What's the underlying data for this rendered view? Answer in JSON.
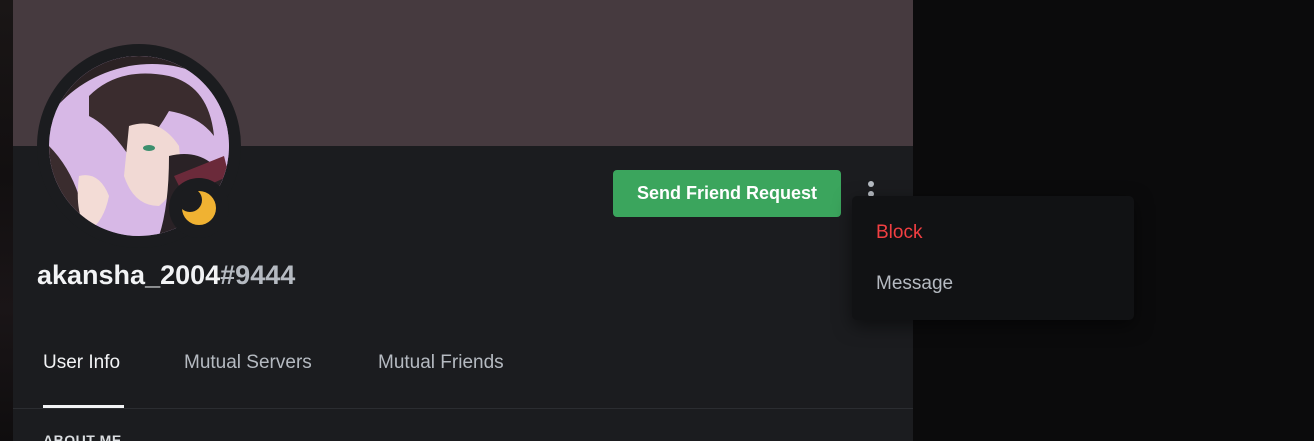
{
  "profile": {
    "username": "akansha_2004",
    "discriminator": "#9444",
    "avatar_alt": "",
    "status_icon": "idle-moon-icon"
  },
  "actions": {
    "send_friend_request_label": "Send Friend Request",
    "more_icon": "more-vertical-icon"
  },
  "context_menu": {
    "items": [
      {
        "label": "Block",
        "variant": "danger"
      },
      {
        "label": "Message",
        "variant": "normal"
      }
    ]
  },
  "tabs": [
    {
      "label": "User Info",
      "active": true
    },
    {
      "label": "Mutual Servers",
      "active": false
    },
    {
      "label": "Mutual Friends",
      "active": false
    }
  ],
  "section": {
    "heading": "ABOUT ME"
  },
  "colors": {
    "banner": "#463a3f",
    "background": "#1b1c1f",
    "button_green": "#3ba55d",
    "danger": "#f23f42",
    "idle_yellow": "#f0b232"
  }
}
